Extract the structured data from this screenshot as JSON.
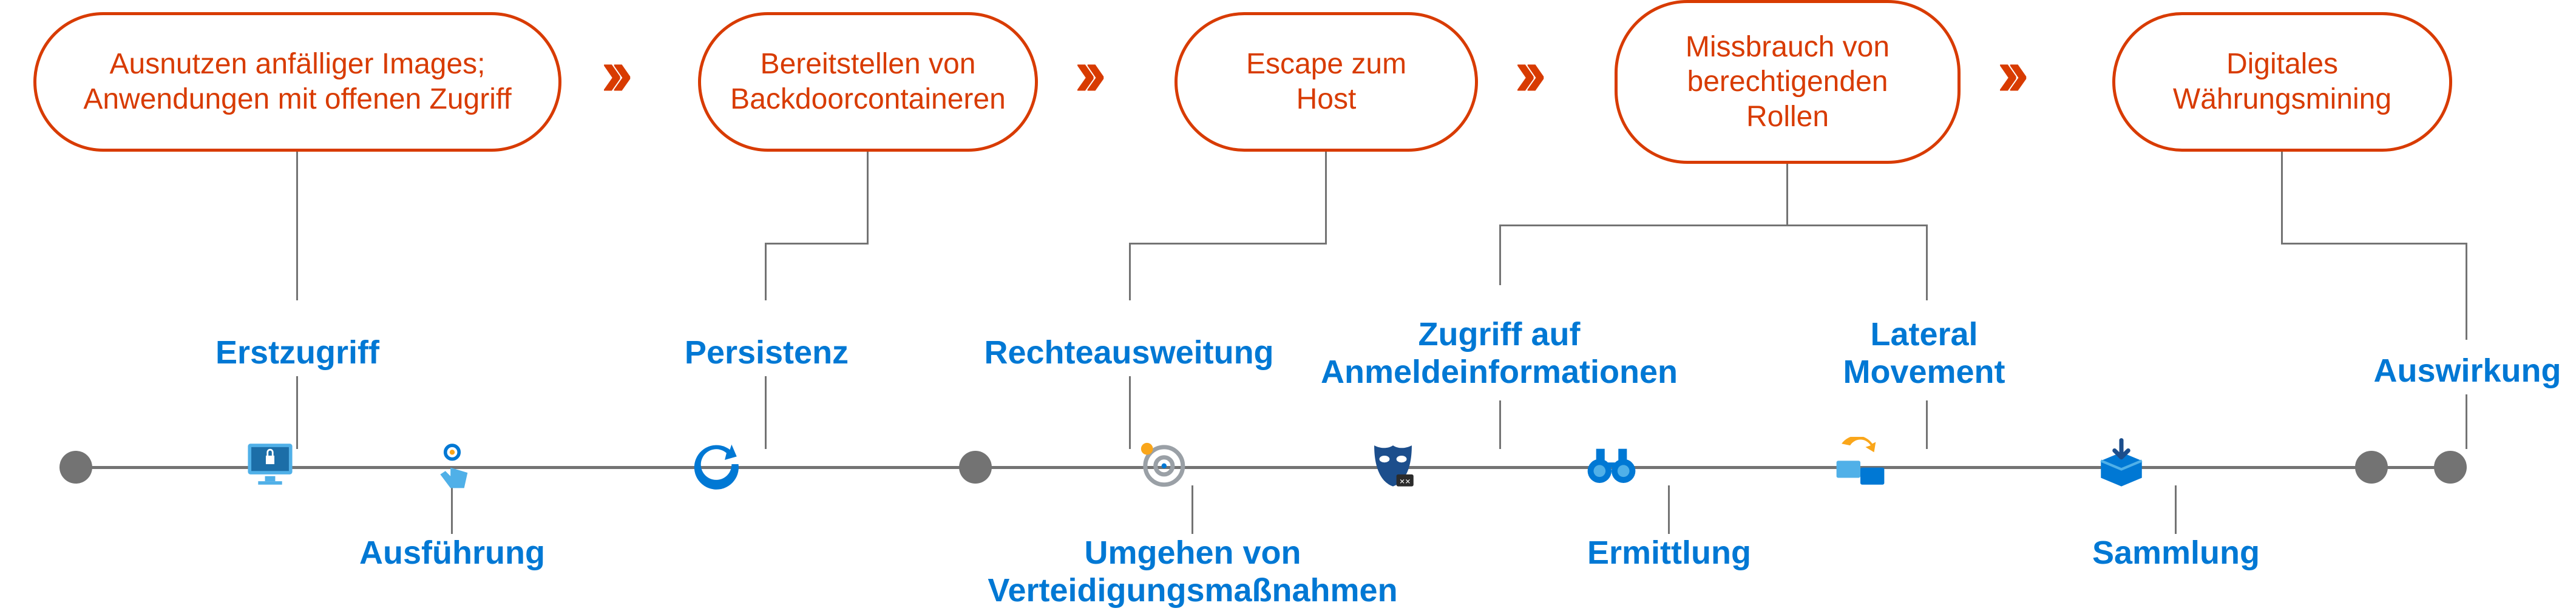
{
  "pills": {
    "p1": "Ausnutzen anfälliger Images;\nAnwendungen mit offenen Zugriff",
    "p2": "Bereitstellen von\nBackdoorcontaineren",
    "p3": "Escape zum\nHost",
    "p4": "Missbrauch von\nberechtigenden\nRollen",
    "p5": "Digitales\nWährungsmining"
  },
  "tactics": {
    "t1": "Erstzugriff",
    "t2": "Ausführung",
    "t3": "Persistenz",
    "t4": "Rechteausweitung",
    "t5": "Umgehen von\nVerteidigungsmaßnahmen",
    "t6": "Zugriff auf\nAnmeldeinformationen",
    "t7": "Ermittlung",
    "t8": "Lateral\nMovement",
    "t9": "Sammlung",
    "t10": "Auswirkung"
  },
  "colors": {
    "brand": "#d83b01",
    "link": "#0078d4",
    "grey": "#737373"
  }
}
